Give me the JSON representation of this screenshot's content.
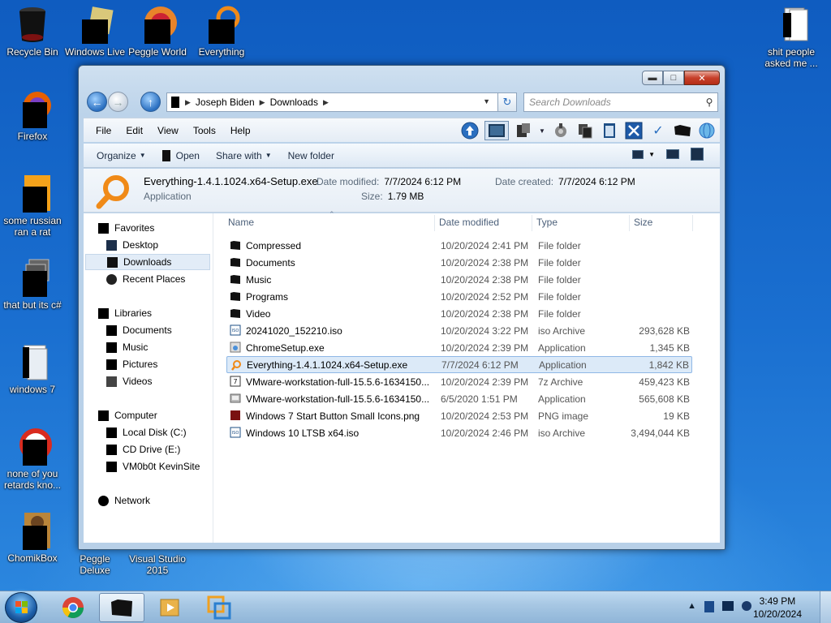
{
  "desktop": {
    "icons": [
      {
        "label": "Recycle Bin",
        "icon": "recycle-bin-icon"
      },
      {
        "label": "Windows Live Mail",
        "icon": "windows-live-mail-icon"
      },
      {
        "label": "Peggle World of Warcraft",
        "icon": "peggle-icon"
      },
      {
        "label": "Everything",
        "icon": "everything-icon"
      },
      {
        "label": "Firefox",
        "icon": "firefox-icon"
      },
      {
        "label": "some russian ran a rat",
        "icon": "app-icon"
      },
      {
        "label": "that but its c#",
        "icon": "app-icon"
      },
      {
        "label": "windows 7",
        "icon": "folder-icon"
      },
      {
        "label": "none of you retards kno...",
        "icon": "app-icon"
      },
      {
        "label": "ChomikBox",
        "icon": "chomikbox-icon"
      },
      {
        "label": "Peggle Deluxe",
        "icon": "peggle-icon"
      },
      {
        "label": "Visual Studio 2015",
        "icon": "visual-studio-icon"
      },
      {
        "label": "shit people asked me ...",
        "icon": "folder-icon"
      }
    ]
  },
  "window": {
    "breadcrumb": [
      "Joseph Biden",
      "Downloads"
    ],
    "search_placeholder": "Search Downloads",
    "menu": [
      "File",
      "Edit",
      "View",
      "Tools",
      "Help"
    ],
    "commands": {
      "organize": "Organize",
      "open": "Open",
      "share_with": "Share with",
      "new_folder": "New folder"
    },
    "details": {
      "name": "Everything-1.4.1.1024.x64-Setup.exe",
      "type": "Application",
      "date_modified_label": "Date modified:",
      "date_modified": "7/7/2024 6:12 PM",
      "date_created_label": "Date created:",
      "date_created": "7/7/2024 6:12 PM",
      "size_label": "Size:",
      "size": "1.79 MB"
    },
    "nav_pane": {
      "favorites": "Favorites",
      "desktop": "Desktop",
      "downloads": "Downloads",
      "recent_places": "Recent Places",
      "libraries": "Libraries",
      "documents": "Documents",
      "music": "Music",
      "pictures": "Pictures",
      "videos": "Videos",
      "computer": "Computer",
      "local_disk": "Local Disk (C:)",
      "cd_drive": "CD Drive (E:)",
      "vm_share": "VM0b0t KevinSite",
      "network": "Network"
    },
    "columns": {
      "name": "Name",
      "date_modified": "Date modified",
      "type": "Type",
      "size": "Size"
    },
    "files": [
      {
        "name": "Compressed",
        "date": "10/20/2024 2:41 PM",
        "type": "File folder",
        "size": "",
        "icon": "folder-icon"
      },
      {
        "name": "Documents",
        "date": "10/20/2024 2:38 PM",
        "type": "File folder",
        "size": "",
        "icon": "folder-icon"
      },
      {
        "name": "Music",
        "date": "10/20/2024 2:38 PM",
        "type": "File folder",
        "size": "",
        "icon": "folder-icon"
      },
      {
        "name": "Programs",
        "date": "10/20/2024 2:52 PM",
        "type": "File folder",
        "size": "",
        "icon": "folder-icon"
      },
      {
        "name": "Video",
        "date": "10/20/2024 2:38 PM",
        "type": "File folder",
        "size": "",
        "icon": "folder-icon"
      },
      {
        "name": "20241020_152210.iso",
        "date": "10/20/2024 3:22 PM",
        "type": "iso Archive",
        "size": "293,628 KB",
        "icon": "iso-icon"
      },
      {
        "name": "ChromeSetup.exe",
        "date": "10/20/2024 2:39 PM",
        "type": "Application",
        "size": "1,345 KB",
        "icon": "setup-icon"
      },
      {
        "name": "Everything-1.4.1.1024.x64-Setup.exe",
        "date": "7/7/2024 6:12 PM",
        "type": "Application",
        "size": "1,842 KB",
        "icon": "everything-icon"
      },
      {
        "name": "VMware-workstation-full-15.5.6-1634150...",
        "date": "10/20/2024 2:39 PM",
        "type": "7z Archive",
        "size": "459,423 KB",
        "icon": "archive-icon"
      },
      {
        "name": "VMware-workstation-full-15.5.6-1634150...",
        "date": "6/5/2020 1:51 PM",
        "type": "Application",
        "size": "565,608 KB",
        "icon": "vmware-icon"
      },
      {
        "name": "Windows 7 Start Button Small Icons.png",
        "date": "10/20/2024 2:53 PM",
        "type": "PNG image",
        "size": "19 KB",
        "icon": "image-icon"
      },
      {
        "name": "Windows 10 LTSB x64.iso",
        "date": "10/20/2024 2:46 PM",
        "type": "iso Archive",
        "size": "3,494,044 KB",
        "icon": "iso-icon"
      }
    ],
    "selected_index": 7
  },
  "taskbar": {
    "time": "3:49 PM",
    "date": "10/20/2024"
  },
  "colors": {
    "selection": "#dceaf8",
    "selection_border": "#8fb8e6",
    "accent": "#2a6fc0"
  }
}
